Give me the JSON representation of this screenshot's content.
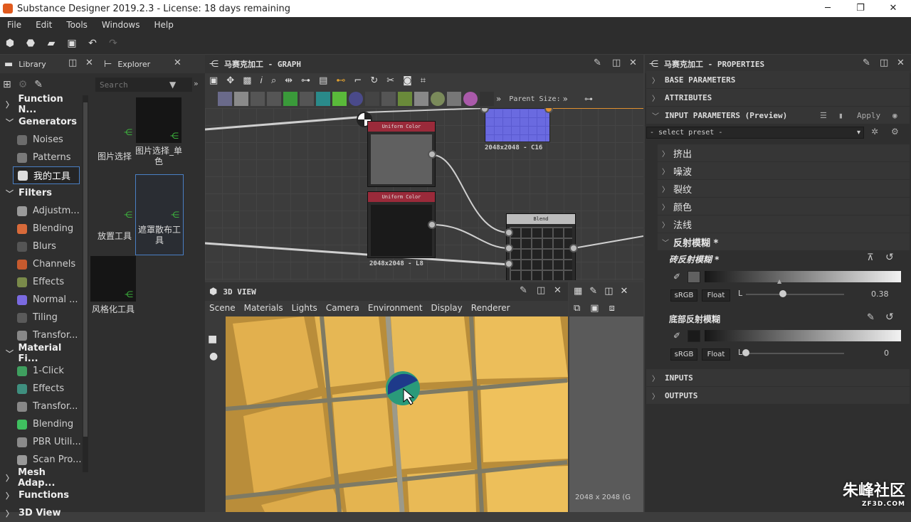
{
  "titlebar": {
    "title": "Substance Designer 2019.2.3 - License: 18 days remaining",
    "minimize": "─",
    "restore": "❐",
    "close": "✕"
  },
  "menu": [
    "File",
    "Edit",
    "Tools",
    "Windows",
    "Help"
  ],
  "library": {
    "tab_label": "Library",
    "items": [
      {
        "type": "cat",
        "label": "Function N...",
        "open": false
      },
      {
        "type": "cat",
        "label": "Generators",
        "open": true
      },
      {
        "type": "item",
        "label": "Noises",
        "color": "#6c6c6c"
      },
      {
        "type": "item",
        "label": "Patterns",
        "color": "#7a7a7a"
      },
      {
        "type": "item",
        "label": "我的工具",
        "color": "#dddddd",
        "selected": true
      },
      {
        "type": "cat",
        "label": "Filters",
        "open": true
      },
      {
        "type": "item",
        "label": "Adjustm...",
        "color": "#9a9a9a"
      },
      {
        "type": "item",
        "label": "Blending",
        "color": "#d86a3a"
      },
      {
        "type": "item",
        "label": "Blurs",
        "color": "#555555"
      },
      {
        "type": "item",
        "label": "Channels",
        "color": "#c65a2e"
      },
      {
        "type": "item",
        "label": "Effects",
        "color": "#7a8a4a"
      },
      {
        "type": "item",
        "label": "Normal ...",
        "color": "#7a6ae0"
      },
      {
        "type": "item",
        "label": "Tiling",
        "color": "#5a5a5a"
      },
      {
        "type": "item",
        "label": "Transfor...",
        "color": "#888888"
      },
      {
        "type": "cat",
        "label": "Material Fi...",
        "open": true
      },
      {
        "type": "item",
        "label": "1-Click",
        "color": "#3f9f5f"
      },
      {
        "type": "item",
        "label": "Effects",
        "color": "#3f8f7f"
      },
      {
        "type": "item",
        "label": "Transfor...",
        "color": "#888888"
      },
      {
        "type": "item",
        "label": "Blending",
        "color": "#3fbf5f"
      },
      {
        "type": "item",
        "label": "PBR Utili...",
        "color": "#8a8a8a"
      },
      {
        "type": "item",
        "label": "Scan Pro...",
        "color": "#999999"
      },
      {
        "type": "cat",
        "label": "Mesh Adap...",
        "open": false
      },
      {
        "type": "cat",
        "label": "Functions",
        "open": false
      },
      {
        "type": "cat",
        "label": "3D View",
        "open": false
      }
    ]
  },
  "explorer": {
    "tab_label": "Explorer",
    "search_placeholder": "Search",
    "cells": [
      {
        "label": "",
        "sublabel": "图片选择"
      },
      {
        "label": "图片选择_单色",
        "sublabel": ""
      },
      {
        "label": "",
        "sublabel": "放置工具"
      },
      {
        "label": "遮罩散布工具",
        "sublabel": "",
        "selected": true
      },
      {
        "label": "风格化工具",
        "sublabel": ""
      }
    ]
  },
  "graph": {
    "title": "马赛克加工 - GRAPH",
    "parent_size_label": "Parent Size:",
    "nodes": {
      "uniform1": "Uniform Color",
      "uniform2": "Uniform Color",
      "blend": "Blend",
      "uniform2_size": "2048x2048 - L8",
      "top_size": "2048x2048 - C16"
    }
  },
  "view3d": {
    "title": "3D VIEW",
    "menu": [
      "Scene",
      "Materials",
      "Lights",
      "Camera",
      "Environment",
      "Display",
      "Renderer"
    ],
    "side_label": "2048 x 2048 (G"
  },
  "properties": {
    "title": "马赛克加工 - PROPERTIES",
    "sections": {
      "base": "BASE PARAMETERS",
      "attributes": "ATTRIBUTES",
      "input": "INPUT PARAMETERS (Preview)",
      "inputs": "INPUTS",
      "outputs": "OUTPUTS"
    },
    "apply_label": "Apply",
    "preset_placeholder": "- select preset -",
    "groups": [
      "挤出",
      "噪波",
      "裂纹",
      "颜色",
      "法线"
    ],
    "open_group": "反射模糊 *",
    "params": [
      {
        "name": "砖反射模糊 *",
        "swatch": "#606060",
        "srgb": "sRGB",
        "fmt": "Float",
        "channel": "L",
        "value_text": "0.38",
        "value": 0.38
      },
      {
        "name": "底部反射模糊",
        "swatch": "#1a1a1a",
        "srgb": "sRGB",
        "fmt": "Float",
        "channel": "L",
        "value_text": "0",
        "value": 0
      }
    ]
  },
  "watermark": {
    "main": "朱峰社区",
    "sub": "ZF3D.COM"
  }
}
